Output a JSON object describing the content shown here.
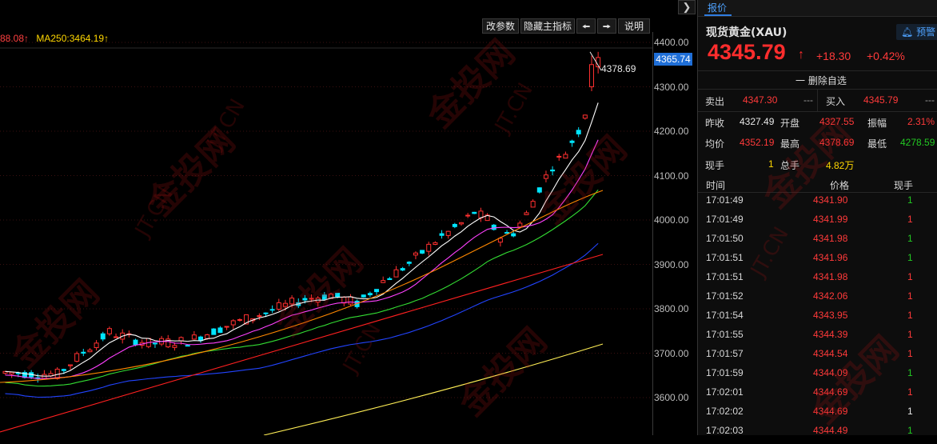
{
  "chart": {
    "ma_legend": {
      "ma_prev": "88.08↑",
      "ma250": "MA250:3464.19↑"
    },
    "toolbar": {
      "params_label": "改参数",
      "hide_label": "隐藏主指标",
      "prev_icon": "left-arrow-icon",
      "next_icon": "right-arrow-icon",
      "help_label": "说明"
    },
    "collapse_icon": "chevron-right-icon",
    "current_price_tag": "4365.74",
    "high_label": "4378.69",
    "y_ticks": [
      "4400.00",
      "4300.00",
      "4200.00",
      "4100.00",
      "4000.00",
      "3900.00",
      "3800.00",
      "3700.00",
      "3600.00"
    ],
    "colors": {
      "up": "#ff3030",
      "down": "#00e5ff",
      "ma5": "#ffffff",
      "ma10": "#ff40ff",
      "ma20": "#33dd33",
      "ma40": "#2244ff",
      "ma60": "#ff8800",
      "ma120": "#ff2020",
      "ma250": "#ffee55"
    }
  },
  "watermark": {
    "logo_text": "金投网",
    "domain_text": "JT.CN"
  },
  "panel": {
    "tab_label": "报价",
    "instrument": "现货黄金(XAU)",
    "alert_label": "预警",
    "alert_icon": "bell-icon",
    "last_price": "4345.79",
    "arrow": "↑",
    "change": "+18.30",
    "change_pct": "+0.42%",
    "watch_label": "一 删除自选",
    "bid_label": "卖出",
    "bid_value": "4347.30",
    "bid_vol": "---",
    "ask_label": "买入",
    "ask_value": "4345.79",
    "ask_vol": "---",
    "prev_close_label": "昨收",
    "prev_close": "4327.49",
    "open_label": "开盘",
    "open": "4327.55",
    "amplitude_label": "振幅",
    "amplitude": "2.31%",
    "avg_label": "均价",
    "avg": "4352.19",
    "high_label": "最高",
    "high": "4378.69",
    "low_label": "最低",
    "low": "4278.59",
    "cur_vol_label": "现手",
    "cur_vol": "1",
    "total_vol_label": "总手",
    "total_vol": "4.82万",
    "ticks_header": {
      "time": "时间",
      "price": "价格",
      "vol": "现手"
    },
    "ticks": [
      {
        "time": "17:01:49",
        "price": "4341.90",
        "vol": "1",
        "dir": "green"
      },
      {
        "time": "17:01:49",
        "price": "4341.99",
        "vol": "1",
        "dir": "red"
      },
      {
        "time": "17:01:50",
        "price": "4341.98",
        "vol": "1",
        "dir": "green"
      },
      {
        "time": "17:01:51",
        "price": "4341.96",
        "vol": "1",
        "dir": "green"
      },
      {
        "time": "17:01:51",
        "price": "4341.98",
        "vol": "1",
        "dir": "red"
      },
      {
        "time": "17:01:52",
        "price": "4342.06",
        "vol": "1",
        "dir": "red"
      },
      {
        "time": "17:01:54",
        "price": "4343.95",
        "vol": "1",
        "dir": "red"
      },
      {
        "time": "17:01:55",
        "price": "4344.39",
        "vol": "1",
        "dir": "red"
      },
      {
        "time": "17:01:57",
        "price": "4344.54",
        "vol": "1",
        "dir": "red"
      },
      {
        "time": "17:01:59",
        "price": "4344.09",
        "vol": "1",
        "dir": "green"
      },
      {
        "time": "17:02:01",
        "price": "4344.69",
        "vol": "1",
        "dir": "red"
      },
      {
        "time": "17:02:02",
        "price": "4344.69",
        "vol": "1",
        "dir": "white"
      },
      {
        "time": "17:02:03",
        "price": "4344.49",
        "vol": "1",
        "dir": "green"
      }
    ]
  }
}
